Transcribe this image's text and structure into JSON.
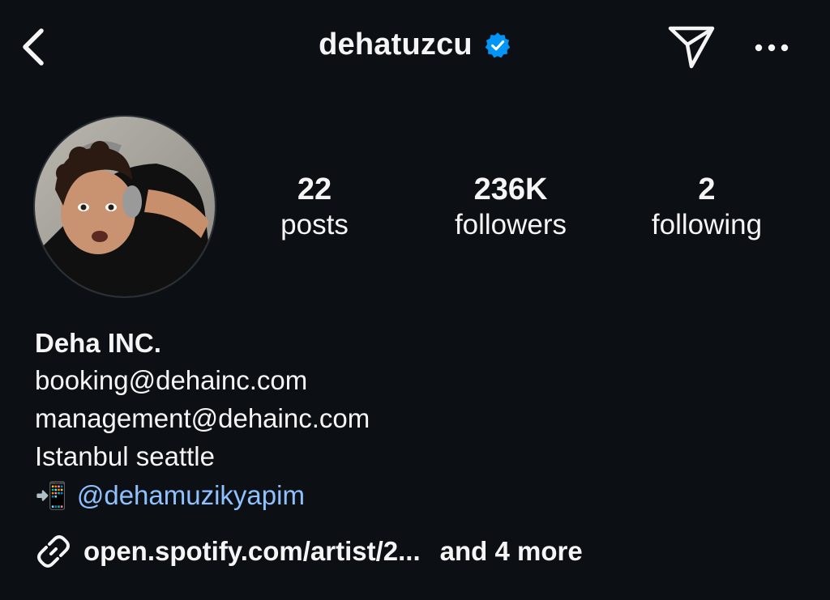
{
  "header": {
    "username": "dehatuzcu",
    "verified": true,
    "icons": {
      "back": "chevron-left-icon",
      "verified": "verified-badge-icon",
      "send": "paper-plane-icon",
      "more": "more-horizontal-icon"
    },
    "accent_color": "#0095f6"
  },
  "profile": {
    "avatar_alt": "profile photo",
    "stats": [
      {
        "value": "22",
        "label": "posts"
      },
      {
        "value": "236K",
        "label": "followers"
      },
      {
        "value": "2",
        "label": "following"
      }
    ]
  },
  "bio": {
    "display_name": "Deha INC.",
    "lines": [
      "booking@dehainc.com",
      "management@dehainc.com",
      "Istanbul seattle"
    ],
    "mention_emoji": "📲",
    "mention": "@dehamuzikyapim",
    "link_icon": "link-icon",
    "link_text": "open.spotify.com/artist/2...",
    "link_more": "and 4 more",
    "mention_color": "#8fc1ff"
  }
}
